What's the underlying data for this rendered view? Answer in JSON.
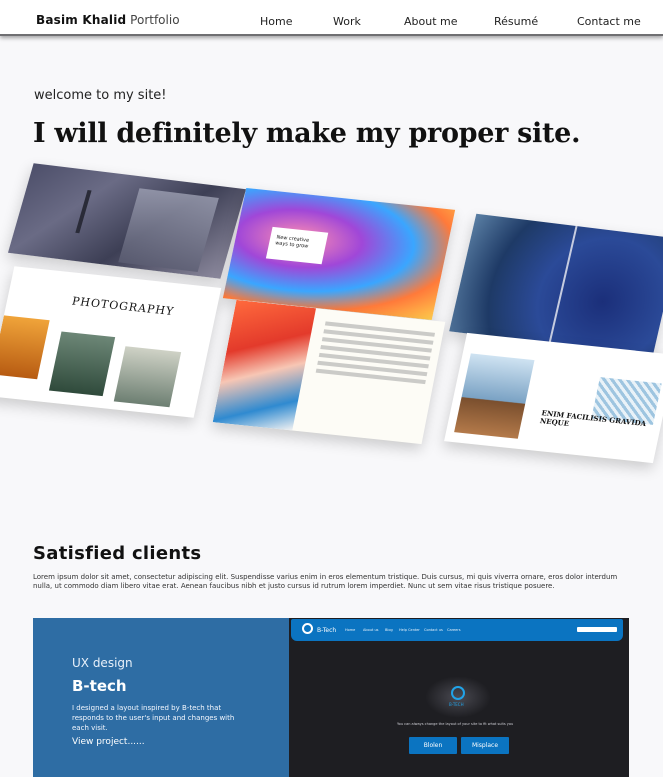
{
  "header": {
    "brand_name": "Basim Khalid",
    "brand_sub": "Portfolio",
    "nav": [
      "Home",
      "Work",
      "About me",
      "Résumé",
      "Contact me"
    ]
  },
  "hero": {
    "welcome": "welcome to my site!",
    "headline": "I will definitely make my proper site."
  },
  "gallery": {
    "mock_photography_title": "PHOTOGRAPHY",
    "mock_card_text": "New creative ways to grow",
    "mock_heading": "ENIM FACILISIS GRAVIDA NEQUE"
  },
  "clients": {
    "title": "Satisfied clients",
    "text": "Lorem ipsum dolor sit amet, consectetur adipiscing elit. Suspendisse varius enim in eros elementum tristique. Duis cursus, mi quis viverra ornare, eros dolor interdum nulla, ut commodo diam libero vitae erat. Aenean faucibus nibh et justo cursus id rutrum lorem imperdiet. Nunc ut sem vitae risus tristique posuere."
  },
  "project": {
    "kind": "UX design",
    "name": "B-tech",
    "description": "I designed a layout inspired by B-tech that responds to the user's input and changes with each visit.",
    "link": "View project......",
    "preview": {
      "brand": "B-Tech",
      "nav": [
        "Home",
        "About us",
        "Blog",
        "Help Center",
        "Contact us",
        "Careers"
      ],
      "emblem_label": "B-TECH",
      "tagline": "You can always change the layout of your site to fit what suits you",
      "buttons": [
        "Blolen",
        "Misplace"
      ]
    }
  },
  "colors": {
    "project_bg": "#2e6da4",
    "preview_bar": "#0b74c1",
    "preview_bg": "#1e1e22"
  }
}
